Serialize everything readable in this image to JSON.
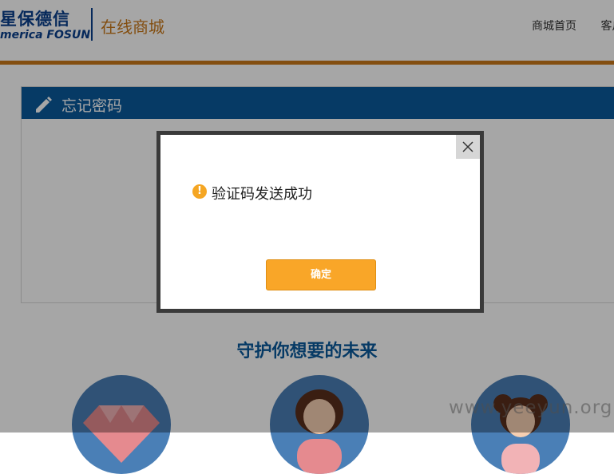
{
  "header": {
    "logo_cn": "星保德信",
    "logo_en": "merica FOSUN",
    "mall_title": "在线商城",
    "nav": [
      "商城首页",
      "客户"
    ]
  },
  "panel": {
    "title": "忘记密码"
  },
  "slogan": "守护你想要的未来",
  "watermark": "www.yeeyun.org",
  "dialog": {
    "message": "验证码发送成功",
    "warn_symbol": "!",
    "ok_label": "确定"
  },
  "colors": {
    "brand_blue": "#0a5a9c",
    "accent_orange": "#f9a628",
    "header_bar": "#c9781a"
  }
}
